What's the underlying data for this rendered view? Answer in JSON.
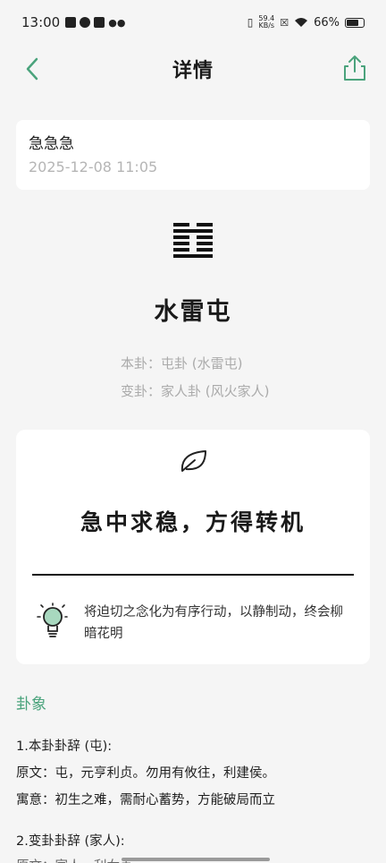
{
  "status_bar": {
    "time": "13:00",
    "net_speed_top": "59.4",
    "net_speed_bottom": "KB/s",
    "battery": "66%"
  },
  "nav": {
    "title": "详情"
  },
  "question_card": {
    "question": "急急急",
    "timestamp": "2025-12-08 11:05"
  },
  "gua": {
    "name": "水雷屯",
    "ben_gua": "本卦：屯卦 (水雷屯)",
    "bian_gua": "变卦：家人卦 (风火家人)"
  },
  "insight_card": {
    "headline": "急中求稳，方得转机",
    "advice": "将迫切之念化为有序行动，以静制动，终会柳暗花明"
  },
  "section": {
    "title": "卦象"
  },
  "details": {
    "ben_heading": "1.本卦卦辞 (屯):",
    "ben_original": "原文：屯，元亨利贞。勿用有攸往，利建侯。",
    "ben_meaning": "寓意：初生之难，需耐心蓄势，方能破局而立",
    "bian_heading": "2.变卦卦辞 (家人):",
    "bian_original": "原文：家人，利女贞。"
  },
  "colors": {
    "accent": "#4aa37c",
    "background": "#f5f5f5",
    "card": "#ffffff"
  }
}
